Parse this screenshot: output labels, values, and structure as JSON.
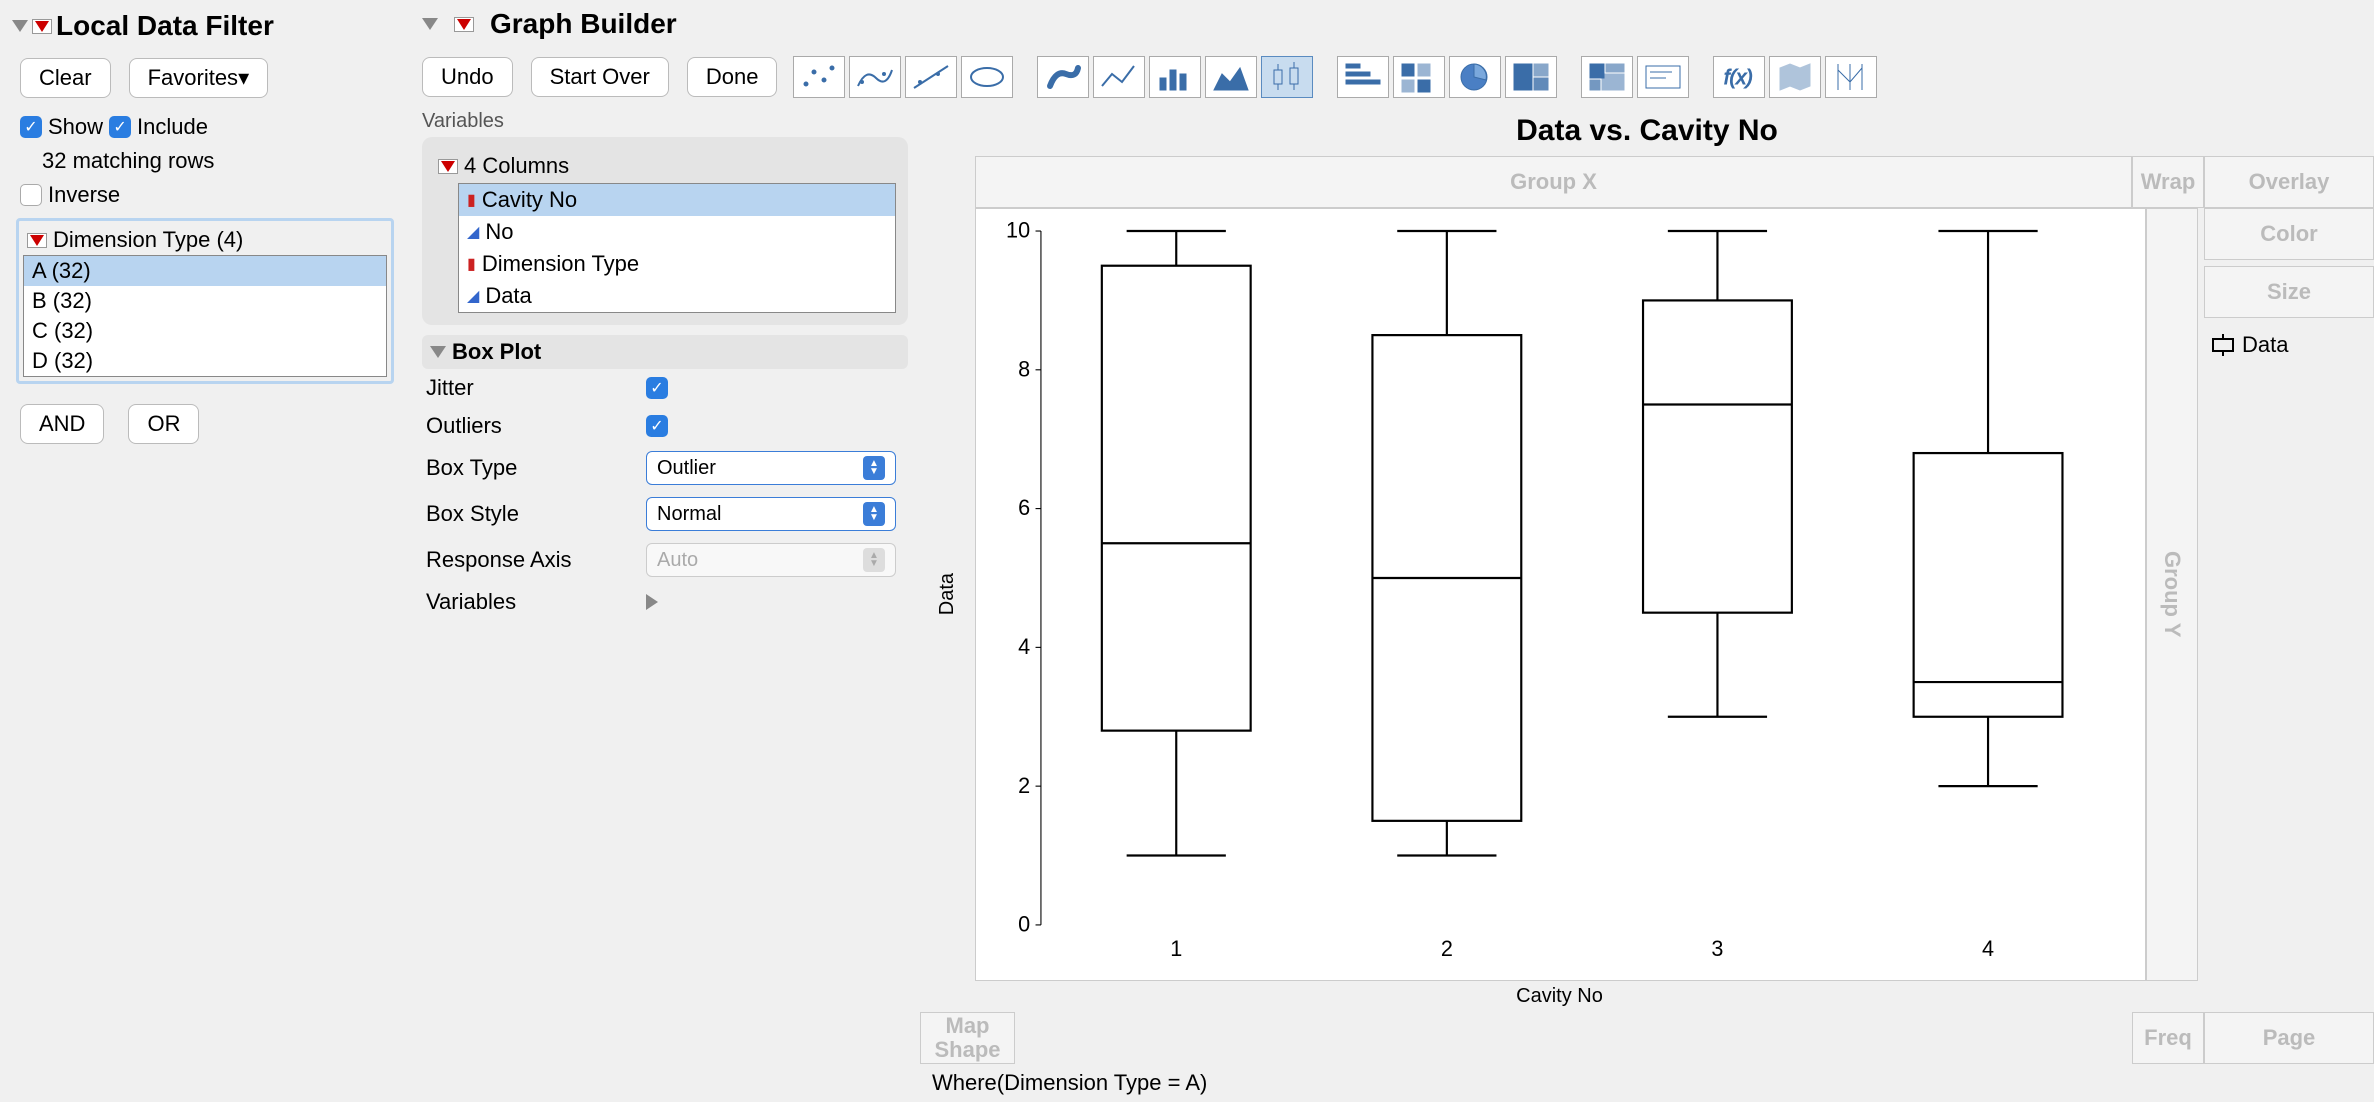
{
  "filter": {
    "title": "Local Data Filter",
    "clear": "Clear",
    "favorites": "Favorites",
    "show": "Show",
    "include": "Include",
    "matching": "32 matching rows",
    "inverse": "Inverse",
    "dim_label": "Dimension Type (4)",
    "items": [
      "A (32)",
      "B (32)",
      "C (32)",
      "D (32)"
    ],
    "and": "AND",
    "or": "OR"
  },
  "gb": {
    "title": "Graph Builder",
    "undo": "Undo",
    "start_over": "Start Over",
    "done": "Done",
    "variables": "Variables",
    "cols_label": "4 Columns",
    "cols": [
      "Cavity No",
      "No",
      "Dimension Type",
      "Data"
    ],
    "col_types": [
      "red",
      "blue",
      "red",
      "blue"
    ],
    "boxplot": "Box Plot",
    "props": {
      "jitter": "Jitter",
      "outliers": "Outliers",
      "box_type": "Box Type",
      "box_type_val": "Outlier",
      "box_style": "Box Style",
      "box_style_val": "Normal",
      "resp_axis": "Response Axis",
      "resp_axis_val": "Auto",
      "variables": "Variables"
    },
    "chart_title": "Data vs. Cavity No",
    "zones": {
      "group_x": "Group X",
      "group_y": "Group Y",
      "wrap": "Wrap",
      "overlay": "Overlay",
      "color": "Color",
      "size": "Size",
      "map_shape": "Map\nShape",
      "freq": "Freq",
      "page": "Page"
    },
    "legend": "Data",
    "ylabel": "Data",
    "xlabel": "Cavity No",
    "where": "Where(Dimension Type = A)"
  },
  "chart_data": {
    "type": "box",
    "title": "Data vs. Cavity No",
    "xlabel": "Cavity No",
    "ylabel": "Data",
    "ylim": [
      0,
      10
    ],
    "yticks": [
      0,
      2,
      4,
      6,
      8,
      10
    ],
    "categories": [
      "1",
      "2",
      "3",
      "4"
    ],
    "boxes": [
      {
        "min": 1.0,
        "q1": 2.8,
        "median": 5.5,
        "q3": 9.5,
        "max": 10.0
      },
      {
        "min": 1.0,
        "q1": 1.5,
        "median": 5.0,
        "q3": 8.5,
        "max": 10.0
      },
      {
        "min": 3.0,
        "q1": 4.5,
        "median": 7.5,
        "q3": 9.0,
        "max": 10.0
      },
      {
        "min": 2.0,
        "q1": 3.0,
        "median": 3.5,
        "q3": 6.8,
        "max": 10.0
      }
    ]
  }
}
